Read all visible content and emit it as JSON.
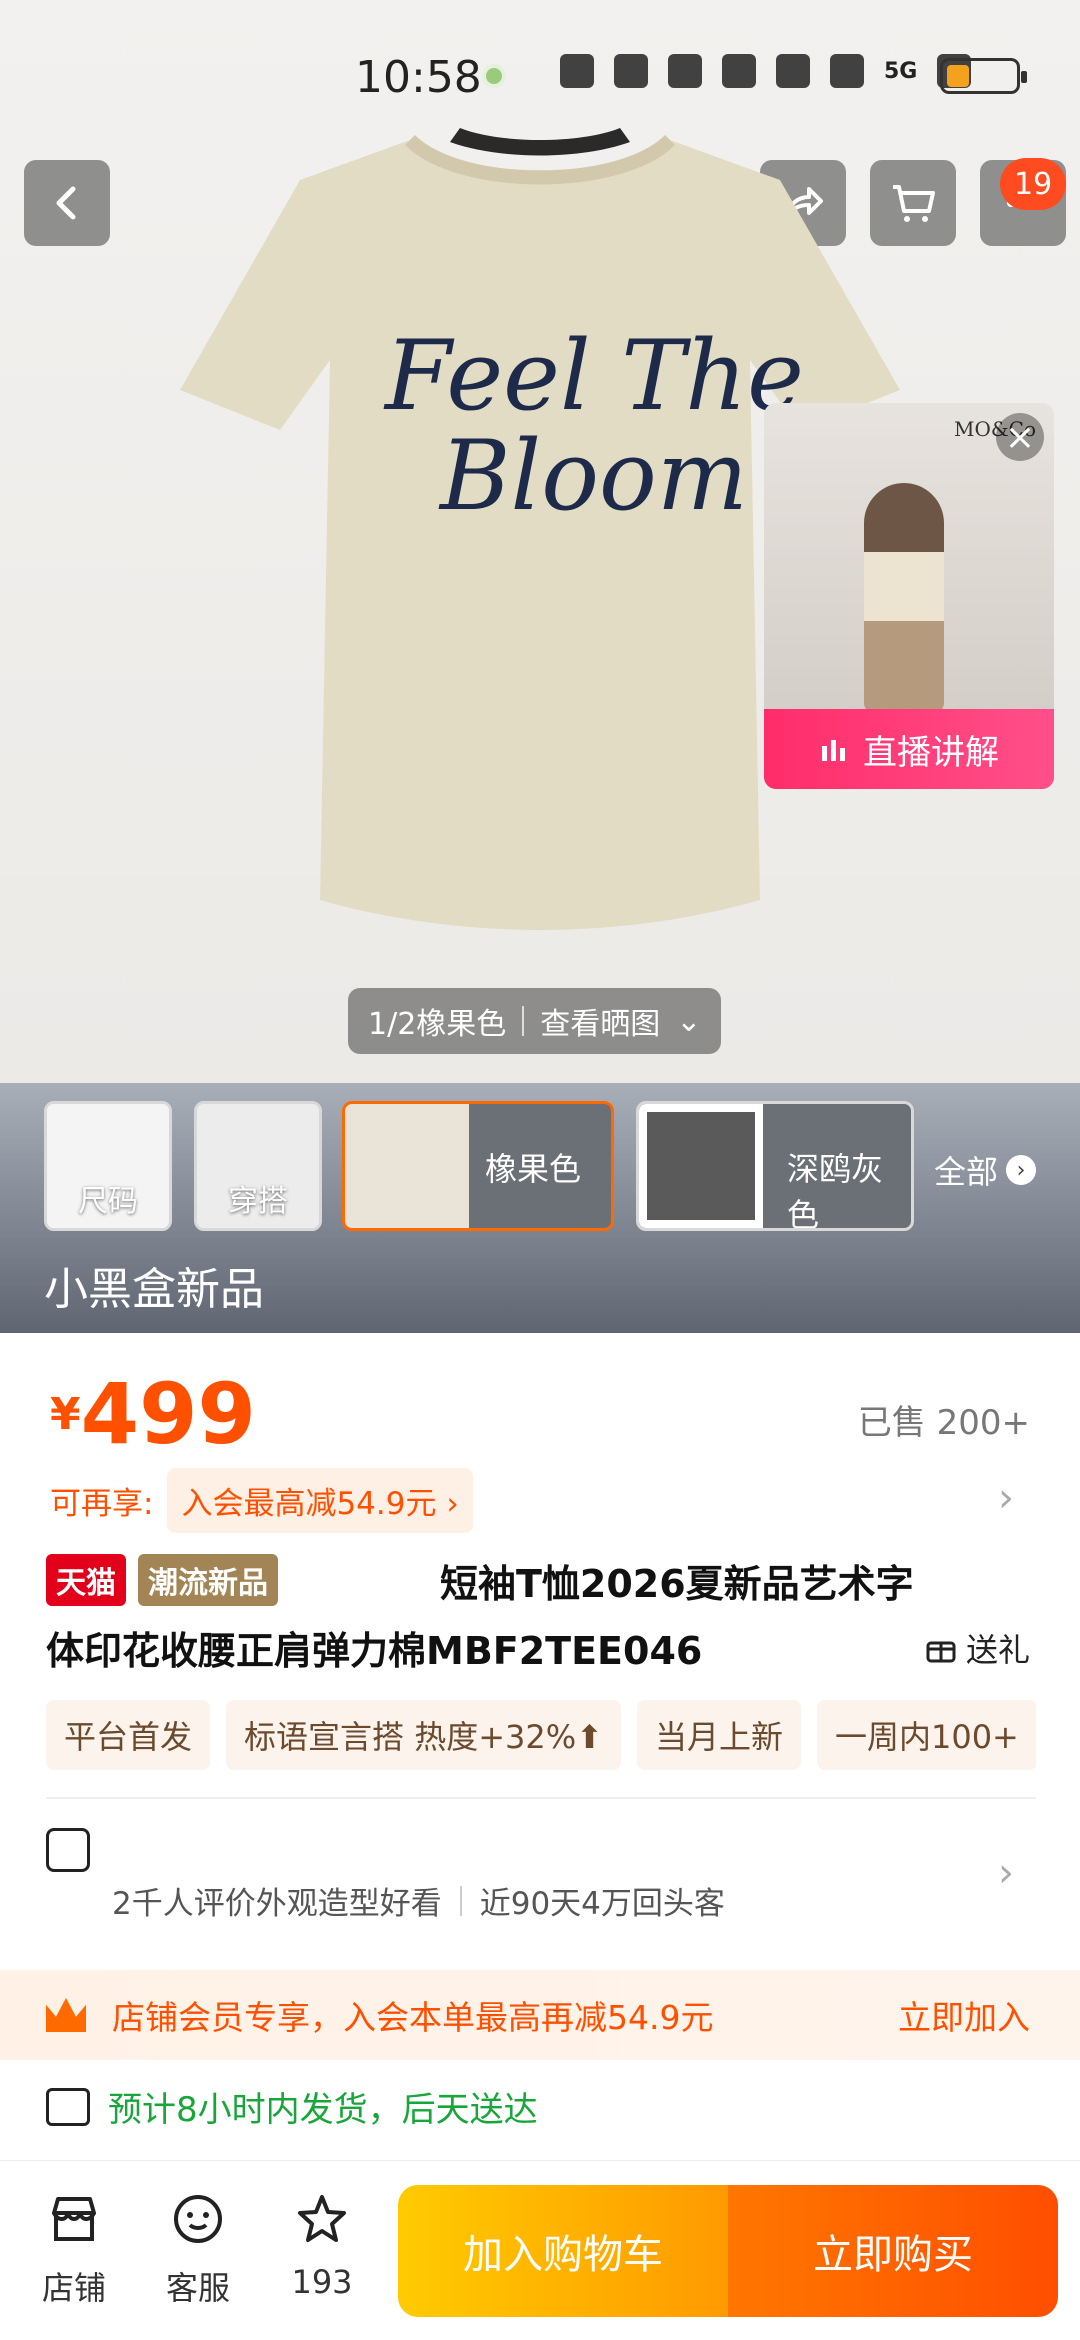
{
  "status_bar": {
    "time": "10:58",
    "network": "5G"
  },
  "header": {
    "cart_badge": "19"
  },
  "hero": {
    "print_line1": "Feel The",
    "print_line2": "Bloom",
    "pager": "1/2橡果色",
    "view_photos": "查看晒图",
    "live": {
      "label": "直播讲解",
      "store_sign": "MO&Co"
    }
  },
  "thumbs": {
    "size": "尺码",
    "outfit": "穿搭",
    "color1": "橡果色",
    "color2": "深鸥灰色",
    "all": "全部",
    "brand_banner": "小黑盒新品"
  },
  "price": {
    "currency": "¥",
    "value": "499",
    "sold": "已售 200+"
  },
  "extra": {
    "label": "可再享:",
    "pill": "入会最高减54.9元 ›"
  },
  "title": {
    "tag_tmall": "天猫",
    "tag_trend": "潮流新品",
    "line1": "短袖T恤2026夏新品艺术字",
    "line2": "体印花收腰正肩弹力棉MBF2TEE046",
    "gift": "送礼"
  },
  "chips": [
    "平台首发",
    "标语宣言搭 热度+32%⬆",
    "当月上新",
    "一周内100+"
  ],
  "store": {
    "review": "2千人评价外观造型好看",
    "repeat": "近90天4万回头客"
  },
  "member": {
    "text": "店铺会员专享，入会本单最高再减54.9元",
    "join": "立即加入"
  },
  "shipping": {
    "text": "预计8小时内发货，后天送达"
  },
  "bottom": {
    "store": "店铺",
    "service": "客服",
    "fav_count": "193",
    "add_cart": "加入购物车",
    "buy_now": "立即购买"
  }
}
